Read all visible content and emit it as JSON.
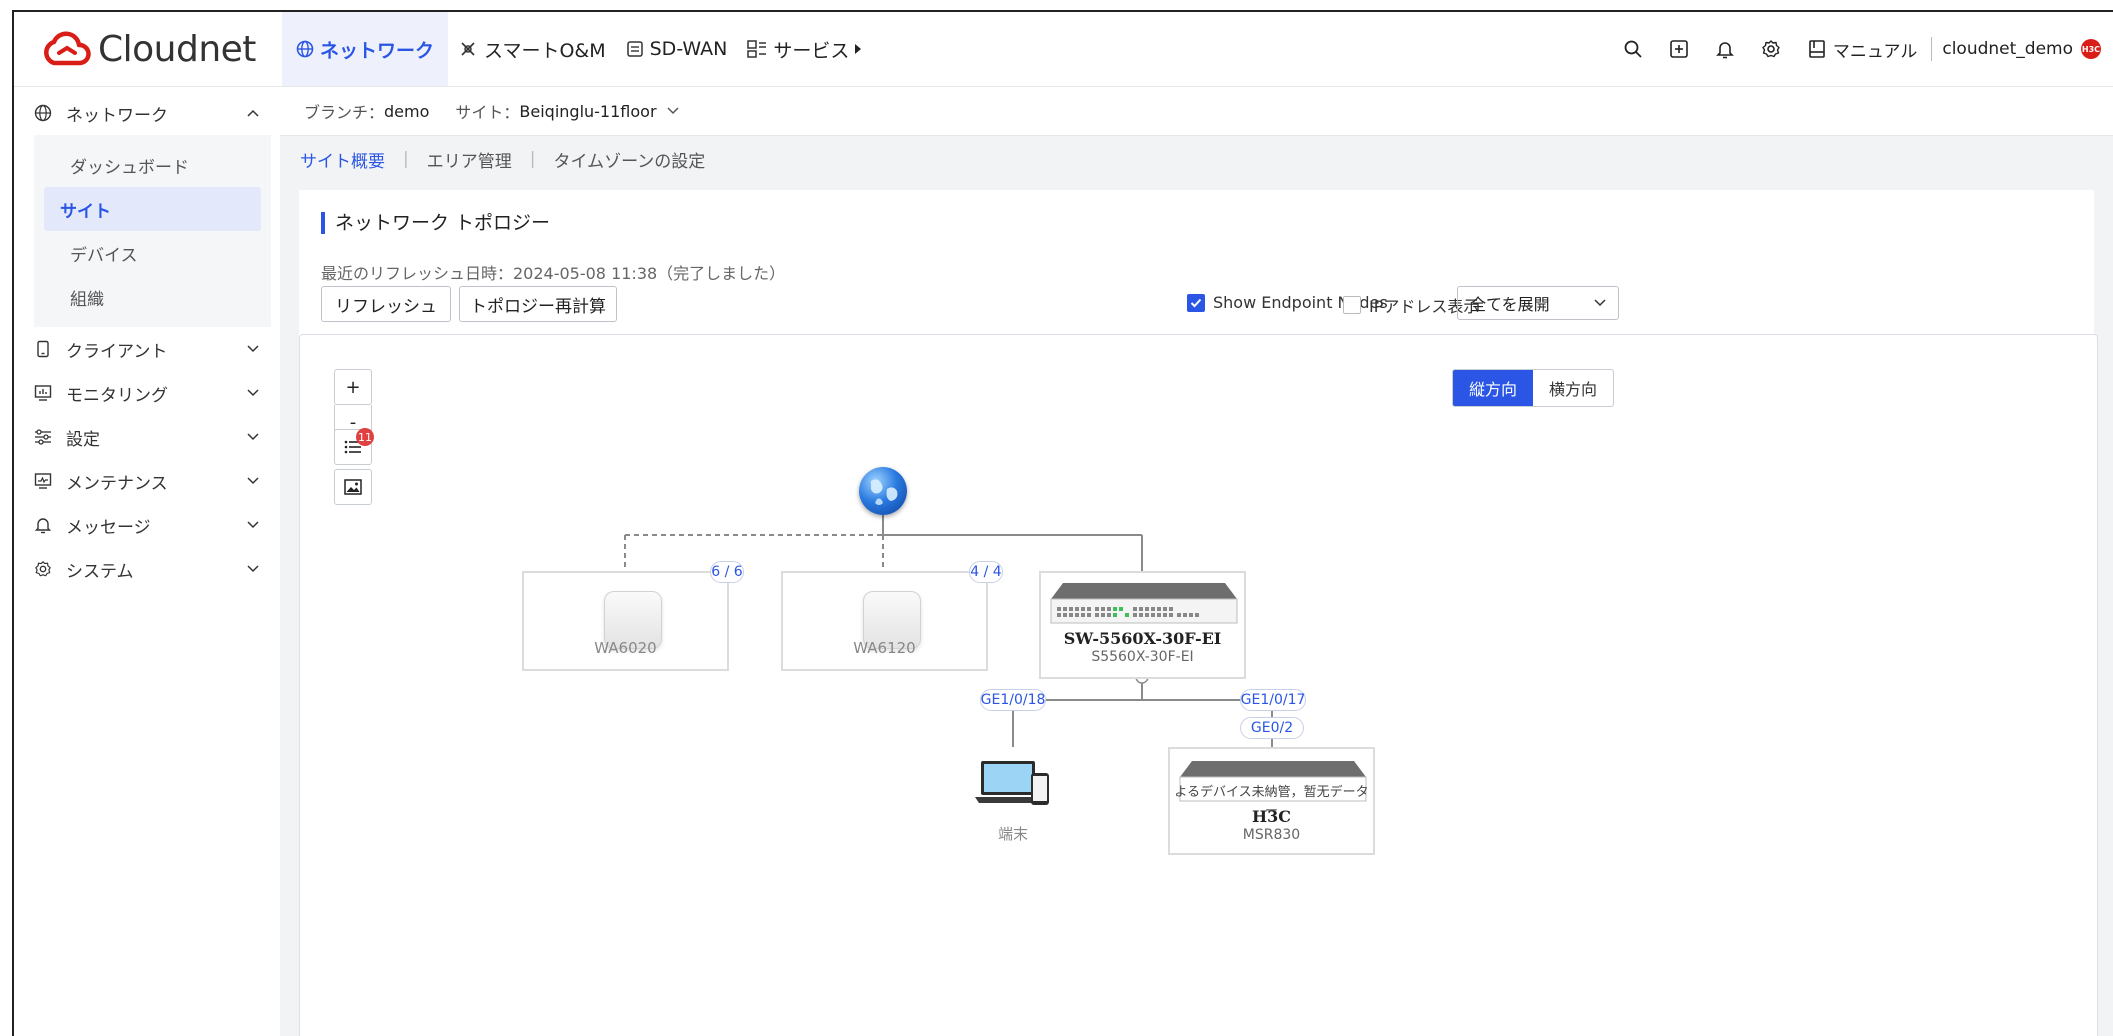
{
  "app": {
    "logo_text": "Cloudnet"
  },
  "topnav": {
    "items": [
      {
        "label": "ネットワーク",
        "icon": "globe-icon",
        "active": true
      },
      {
        "label": "スマートO&M",
        "icon": "sparkle-icon"
      },
      {
        "label": "SD-WAN",
        "icon": "router-icon"
      },
      {
        "label": "サービス",
        "icon": "grid-icon"
      }
    ],
    "manual_label": "マニュアル",
    "username": "cloudnet_demo",
    "avatar_text": "H3C"
  },
  "sidebar": {
    "network": {
      "label": "ネットワーク"
    },
    "network_items": [
      {
        "label": "ダッシュボード"
      },
      {
        "label": "サイト",
        "active": true
      },
      {
        "label": "デバイス"
      },
      {
        "label": "組織"
      }
    ],
    "groups": [
      {
        "label": "クライアント",
        "icon": "client-icon"
      },
      {
        "label": "モニタリング",
        "icon": "monitor-icon"
      },
      {
        "label": "設定",
        "icon": "sliders-icon"
      },
      {
        "label": "メンテナンス",
        "icon": "maintenance-icon"
      },
      {
        "label": "メッセージ",
        "icon": "bell-icon"
      },
      {
        "label": "システム",
        "icon": "gear-icon"
      }
    ]
  },
  "branch_bar": {
    "branch_label": "ブランチ：",
    "branch_value": "demo",
    "site_label": "サイト：",
    "site_value": "Beiqinglu-11floor"
  },
  "tabs": [
    {
      "label": "サイト概要",
      "active": true
    },
    {
      "label": "エリア管理"
    },
    {
      "label": "タイムゾーンの設定"
    }
  ],
  "panel": {
    "title": "ネットワーク トポロジー",
    "refresh_info": "最近のリフレッシュ日時：2024-05-08 11:38（完了しました）",
    "refresh_button": "リフレッシュ",
    "recalc_button": "トポロジー再計算",
    "show_endpoint_label": "Show Endpoint Nodes",
    "show_endpoint_checked": true,
    "ip_display_label": "IPアドレス表示",
    "ip_display_checked": false,
    "expand_select": "全てを展開"
  },
  "topology": {
    "zoom_in": "+",
    "zoom_out": "-",
    "list_badge": "11",
    "orientation": {
      "vertical": "縦方向",
      "horizontal": "横方向",
      "active": "vertical"
    },
    "nodes": {
      "ap1": {
        "name": "WA6020",
        "counter": "6 / 6"
      },
      "ap2": {
        "name": "WA6120",
        "counter": "4 / 4"
      },
      "switch": {
        "name": "SW-5560X-30F-EI",
        "model": "S5560X-30F-EI"
      },
      "endpoint": {
        "name": "端末"
      },
      "router": {
        "status": "よるデバイス未納管，暂无データー",
        "name": "H3C",
        "model": "MSR830"
      }
    },
    "ports": {
      "sw_left": "GE1/0/18",
      "sw_right": "GE1/0/17",
      "router_port": "GE0/2"
    }
  }
}
